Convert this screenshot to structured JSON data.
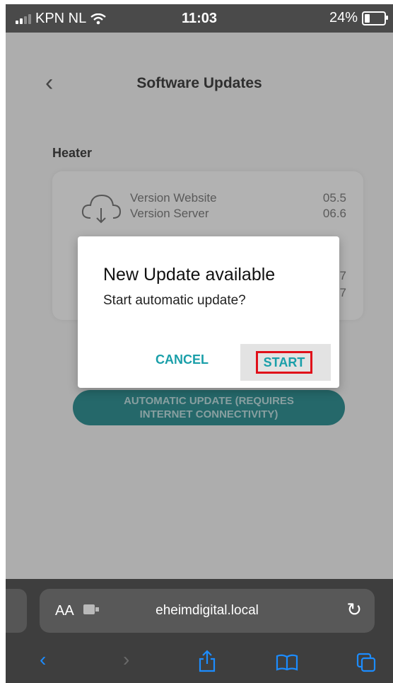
{
  "status_bar": {
    "carrier": "KPN NL",
    "time": "11:03",
    "battery": "24%"
  },
  "page": {
    "title": "Software Updates",
    "section": "Heater",
    "rows": [
      {
        "label": "Version Website",
        "value": "05.5"
      },
      {
        "label": "Version Server",
        "value": "06.6"
      },
      {
        "label": "",
        "value": "7"
      },
      {
        "label": "",
        "value": "7"
      }
    ],
    "auto_update_line1": "AUTOMATIC UPDATE (REQUIRES",
    "auto_update_line2": "INTERNET CONNECTIVITY)"
  },
  "dialog": {
    "title": "New Update available",
    "message": "Start automatic update?",
    "cancel_label": "CANCEL",
    "start_label": "START"
  },
  "browser": {
    "aa_label": "AA",
    "url": "eheimdigital.local"
  },
  "colors": {
    "accent": "#1a9fa9",
    "highlight_border": "#e0101a",
    "button_bg": "#2e7f82"
  }
}
